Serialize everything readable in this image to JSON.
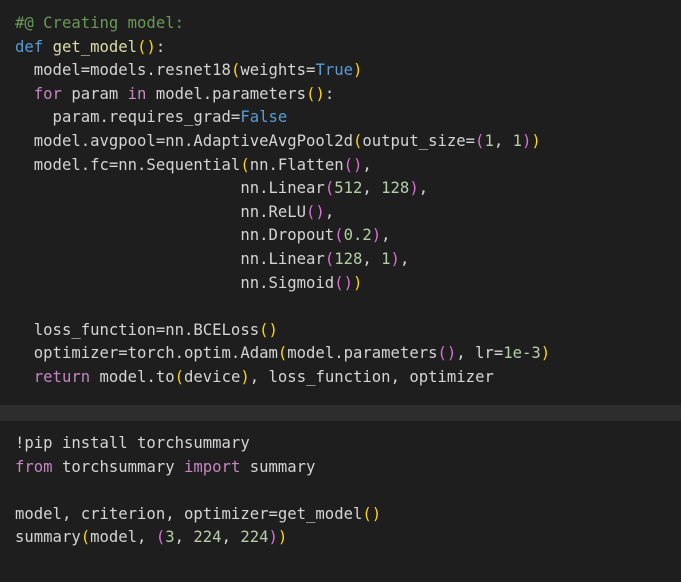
{
  "cells": [
    {
      "lines": [
        [
          {
            "t": "#@ Creating model:",
            "c": "comment"
          }
        ],
        [
          {
            "t": "def",
            "c": "keyword"
          },
          {
            "t": " "
          },
          {
            "t": "get_model",
            "c": "func"
          },
          {
            "t": "(",
            "c": "paren1"
          },
          {
            "t": ")",
            "c": "paren1"
          },
          {
            "t": ":"
          }
        ],
        [
          {
            "t": "  model=models.resnet18"
          },
          {
            "t": "(",
            "c": "paren1"
          },
          {
            "t": "weights="
          },
          {
            "t": "True",
            "c": "keyword"
          },
          {
            "t": ")",
            "c": "paren1"
          }
        ],
        [
          {
            "t": "  "
          },
          {
            "t": "for",
            "c": "control"
          },
          {
            "t": " param "
          },
          {
            "t": "in",
            "c": "control"
          },
          {
            "t": " model.parameters"
          },
          {
            "t": "()",
            "c": "paren1"
          },
          {
            "t": ":"
          }
        ],
        [
          {
            "t": "    param.requires_grad="
          },
          {
            "t": "False",
            "c": "keyword"
          }
        ],
        [
          {
            "t": "  model.avgpool=nn.AdaptiveAvgPool2d"
          },
          {
            "t": "(",
            "c": "paren1"
          },
          {
            "t": "output_size="
          },
          {
            "t": "(",
            "c": "paren2"
          },
          {
            "t": "1",
            "c": "number"
          },
          {
            "t": ", "
          },
          {
            "t": "1",
            "c": "number"
          },
          {
            "t": ")",
            "c": "paren2"
          },
          {
            "t": ")",
            "c": "paren1"
          }
        ],
        [
          {
            "t": "  model.fc=nn.Sequential"
          },
          {
            "t": "(",
            "c": "paren1"
          },
          {
            "t": "nn.Flatten"
          },
          {
            "t": "()",
            "c": "paren2"
          },
          {
            "t": ","
          }
        ],
        [
          {
            "t": "                        nn.Linear"
          },
          {
            "t": "(",
            "c": "paren2"
          },
          {
            "t": "512",
            "c": "number"
          },
          {
            "t": ", "
          },
          {
            "t": "128",
            "c": "number"
          },
          {
            "t": ")",
            "c": "paren2"
          },
          {
            "t": ","
          }
        ],
        [
          {
            "t": "                        nn.ReLU"
          },
          {
            "t": "()",
            "c": "paren2"
          },
          {
            "t": ","
          }
        ],
        [
          {
            "t": "                        nn.Dropout"
          },
          {
            "t": "(",
            "c": "paren2"
          },
          {
            "t": "0.2",
            "c": "number"
          },
          {
            "t": ")",
            "c": "paren2"
          },
          {
            "t": ","
          }
        ],
        [
          {
            "t": "                        nn.Linear"
          },
          {
            "t": "(",
            "c": "paren2"
          },
          {
            "t": "128",
            "c": "number"
          },
          {
            "t": ", "
          },
          {
            "t": "1",
            "c": "number"
          },
          {
            "t": ")",
            "c": "paren2"
          },
          {
            "t": ","
          }
        ],
        [
          {
            "t": "                        nn.Sigmoid"
          },
          {
            "t": "()",
            "c": "paren2"
          },
          {
            "t": ")",
            "c": "paren1"
          }
        ],
        [],
        [
          {
            "t": "  loss_function=nn.BCELoss"
          },
          {
            "t": "()",
            "c": "paren1"
          }
        ],
        [
          {
            "t": "  optimizer=torch.optim.Adam"
          },
          {
            "t": "(",
            "c": "paren1"
          },
          {
            "t": "model.parameters"
          },
          {
            "t": "()",
            "c": "paren2"
          },
          {
            "t": ", lr="
          },
          {
            "t": "1e-3",
            "c": "number"
          },
          {
            "t": ")",
            "c": "paren1"
          }
        ],
        [
          {
            "t": "  "
          },
          {
            "t": "return",
            "c": "control"
          },
          {
            "t": " model.to"
          },
          {
            "t": "(",
            "c": "paren1"
          },
          {
            "t": "device"
          },
          {
            "t": ")",
            "c": "paren1"
          },
          {
            "t": ", loss_function, optimizer"
          }
        ]
      ]
    },
    {
      "lines": [
        [
          {
            "t": "!pip install torchsummary"
          }
        ],
        [
          {
            "t": "from",
            "c": "control"
          },
          {
            "t": " torchsummary "
          },
          {
            "t": "import",
            "c": "control"
          },
          {
            "t": " summary"
          }
        ],
        [],
        [
          {
            "t": "model, criterion, optimizer=get_model"
          },
          {
            "t": "()",
            "c": "paren1"
          }
        ],
        [
          {
            "t": "summary"
          },
          {
            "t": "(",
            "c": "paren1"
          },
          {
            "t": "model, "
          },
          {
            "t": "(",
            "c": "paren2"
          },
          {
            "t": "3",
            "c": "number"
          },
          {
            "t": ", "
          },
          {
            "t": "224",
            "c": "number"
          },
          {
            "t": ", "
          },
          {
            "t": "224",
            "c": "number"
          },
          {
            "t": ")",
            "c": "paren2"
          },
          {
            "t": ")",
            "c": "paren1"
          }
        ]
      ]
    }
  ]
}
